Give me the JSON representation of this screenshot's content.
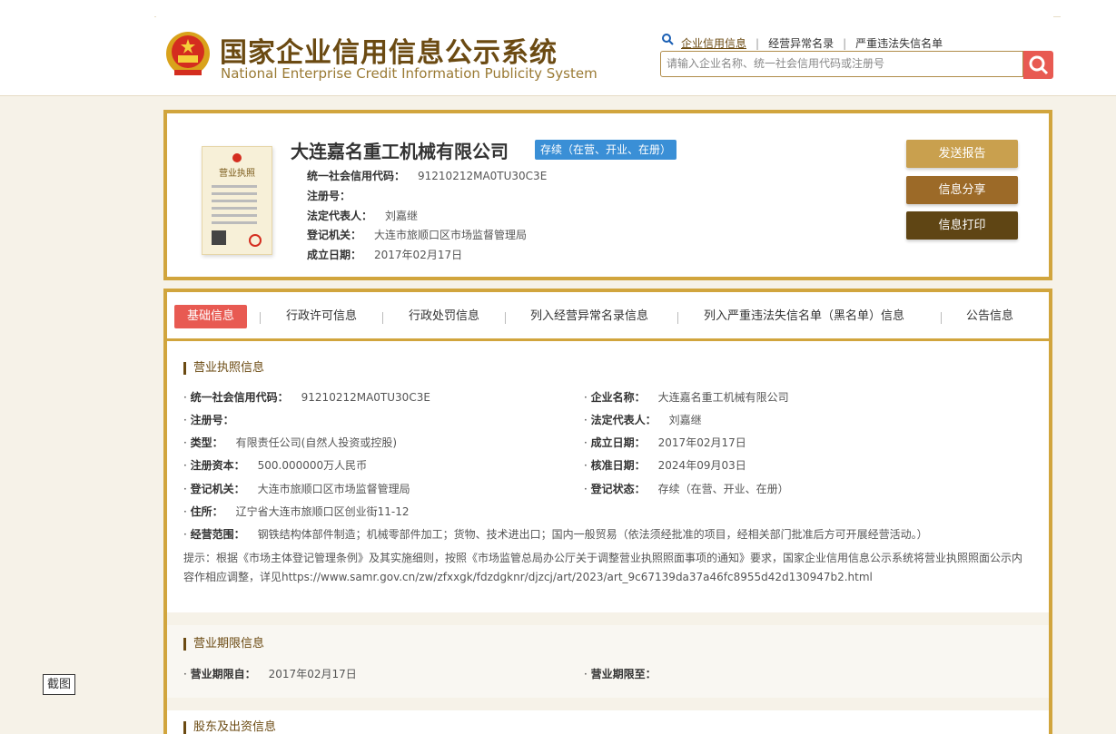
{
  "header": {
    "title_cn": "国家企业信用信息公示系统",
    "title_en": "National Enterprise Credit Information Publicity System",
    "nav": [
      "企业信用信息",
      "经营异常名录",
      "严重违法失信名单"
    ],
    "search_placeholder": "请输入企业名称、统一社会信用代码或注册号"
  },
  "company": {
    "name": "大连嘉名重工机械有限公司",
    "status": "存续（在营、开业、在册）",
    "fields": [
      {
        "label": "统一社会信用代码：",
        "value": "91210212MA0TU30C3E"
      },
      {
        "label": "注册号：",
        "value": ""
      },
      {
        "label": "法定代表人：",
        "value": "刘嘉继"
      },
      {
        "label": "登记机关：",
        "value": "大连市旅顺口区市场监督管理局"
      },
      {
        "label": "成立日期：",
        "value": "2017年02月17日"
      }
    ],
    "license_img_label": "营业执照"
  },
  "actions": [
    "发送报告",
    "信息分享",
    "信息打印"
  ],
  "tabs": [
    "基础信息",
    "行政许可信息",
    "行政处罚信息",
    "列入经营异常名录信息",
    "列入严重违法失信名单（黑名单）信息",
    "公告信息"
  ],
  "license_section": {
    "title": "营业执照信息",
    "left": [
      {
        "label": "统一社会信用代码：",
        "value": "91210212MA0TU30C3E"
      },
      {
        "label": "注册号：",
        "value": ""
      },
      {
        "label": "类型：",
        "value": "有限责任公司(自然人投资或控股)"
      },
      {
        "label": "注册资本：",
        "value": "500.000000万人民币"
      },
      {
        "label": "登记机关：",
        "value": "大连市旅顺口区市场监督管理局"
      },
      {
        "label": "住所：",
        "value": "辽宁省大连市旅顺口区创业街11-12"
      },
      {
        "label": "经营范围：",
        "value": "钢铁结构体部件制造；机械零部件加工；货物、技术进出口；国内一般贸易（依法须经批准的项目，经相关部门批准后方可开展经营活动。）"
      }
    ],
    "right": [
      {
        "label": "企业名称：",
        "value": "大连嘉名重工机械有限公司"
      },
      {
        "label": "法定代表人：",
        "value": "刘嘉继"
      },
      {
        "label": "成立日期：",
        "value": "2017年02月17日"
      },
      {
        "label": "核准日期：",
        "value": "2024年09月03日"
      },
      {
        "label": "登记状态：",
        "value": "存续（在营、开业、在册）"
      }
    ],
    "note": "提示：根据《市场主体登记管理条例》及其实施细则，按照《市场监管总局办公厅关于调整营业执照照面事项的通知》要求，国家企业信用信息公示系统将营业执照照面公示内容作相应调整，详见https://www.samr.gov.cn/zw/zfxxgk/fdzdgknr/djzcj/art/2023/art_9c67139da37a46fc8955d42d130947b2.html"
  },
  "term_section": {
    "title": "营业期限信息",
    "start_label": "营业期限自：",
    "start_value": "2017年02月17日",
    "end_label": "营业期限至：",
    "end_value": ""
  },
  "shareholder_section": {
    "title": "股东及出资信息"
  },
  "screenshot_tag": "截图",
  "colors": {
    "gold": "#d1a53d",
    "brown": "#6b4a12",
    "red": "#e85a52",
    "blue": "#3a8fd6"
  }
}
